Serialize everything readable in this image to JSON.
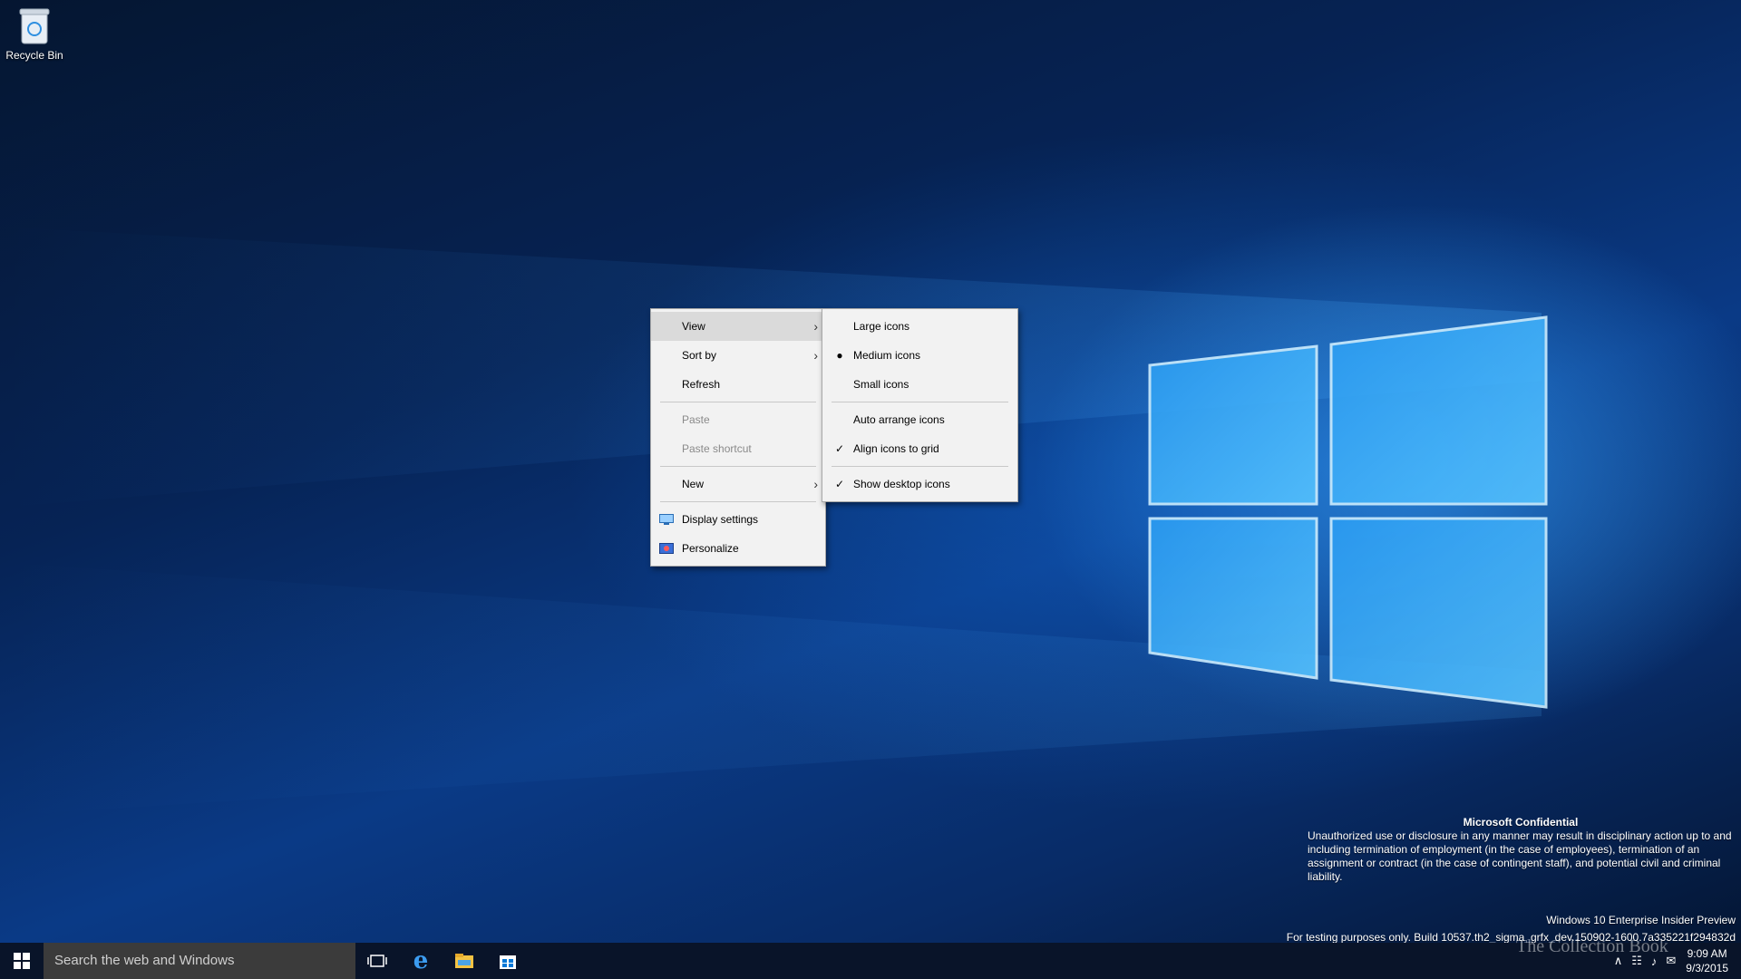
{
  "desktop": {
    "icons": [
      {
        "label": "Recycle Bin",
        "icon": "recycle-bin-icon"
      }
    ]
  },
  "context_menu": {
    "items": [
      {
        "label": "View",
        "submenu": true,
        "highlighted": true
      },
      {
        "label": "Sort by",
        "submenu": true
      },
      {
        "label": "Refresh"
      },
      {
        "label": "Paste",
        "disabled": true
      },
      {
        "label": "Paste shortcut",
        "disabled": true
      },
      {
        "label": "New",
        "submenu": true
      },
      {
        "label": "Display settings",
        "icon": "display-settings-icon"
      },
      {
        "label": "Personalize",
        "icon": "personalize-icon"
      }
    ]
  },
  "view_submenu": {
    "items": [
      {
        "label": "Large icons"
      },
      {
        "label": "Medium icons",
        "marker": "bullet"
      },
      {
        "label": "Small icons"
      },
      {
        "label": "Auto arrange icons"
      },
      {
        "label": "Align icons to grid",
        "marker": "check"
      },
      {
        "label": "Show desktop icons",
        "marker": "check"
      }
    ]
  },
  "watermark": {
    "title": "Microsoft Confidential",
    "body": "Unauthorized use or disclosure in any manner may result in disciplinary action up to and including termination of employment (in the case of employees), termination of an assignment or contract (in the case of contingent staff), and potential civil and criminal liability.",
    "edition": "Windows 10 Enterprise Insider Preview",
    "build": "For testing purposes only. Build 10537.th2_sigma_grfx_dev.150902-1600.7a335221f294832d"
  },
  "taskbar": {
    "search_placeholder": "Search the web and Windows",
    "pinned": [
      "task-view-icon",
      "edge-icon",
      "file-explorer-icon",
      "store-icon"
    ],
    "time": "9:09 AM",
    "date": "9/3/2015"
  },
  "overlay_watermark": "The Collection Book",
  "colors": {
    "menu_bg": "#f2f2f2",
    "menu_highlight": "#dadada",
    "accent": "#0078d7"
  }
}
